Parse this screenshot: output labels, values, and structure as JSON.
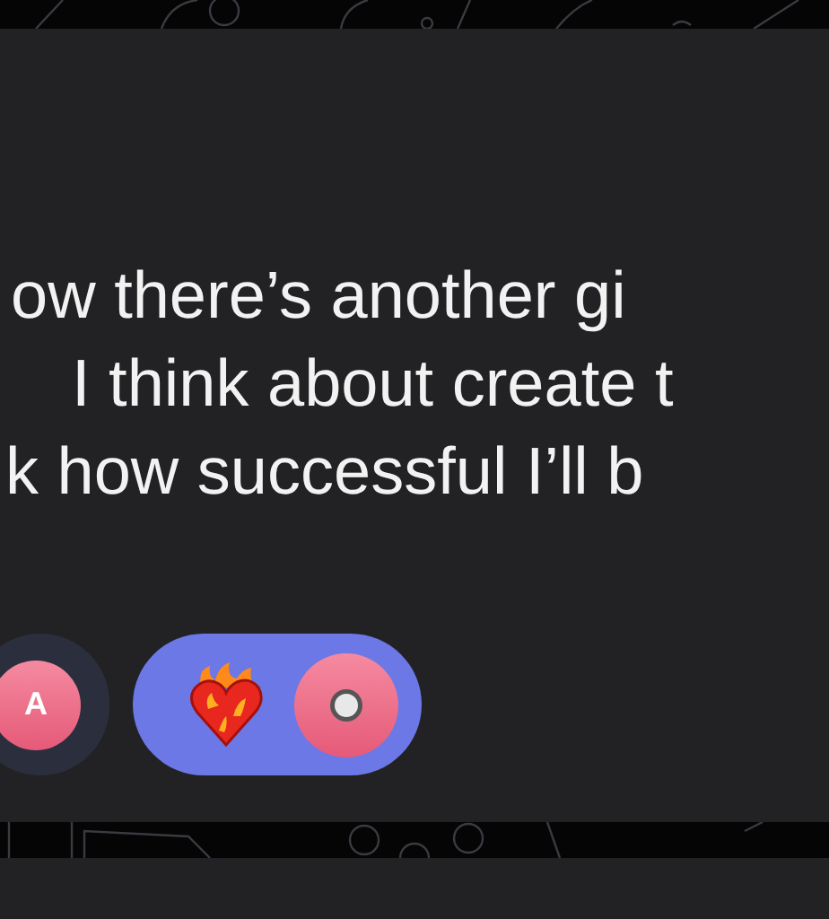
{
  "message": {
    "lines": [
      "ow there’s another gi",
      "I think about create t",
      "k how successful I’ll b"
    ]
  },
  "reactions": [
    {
      "kind": "avatar",
      "selected": false,
      "avatar_letter": "A"
    },
    {
      "kind": "emoji",
      "selected": true
    }
  ]
}
